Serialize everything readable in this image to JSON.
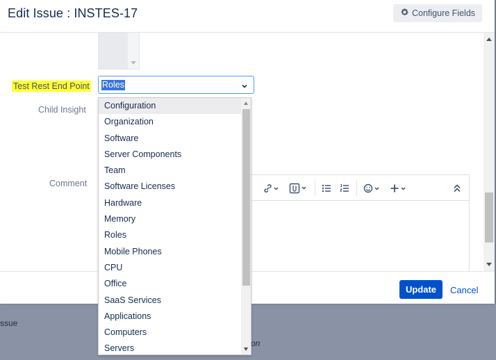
{
  "modal": {
    "title": "Edit Issue : INSTES-17",
    "configure_label": "Configure Fields"
  },
  "fields": {
    "test_rest_label": "Test Rest End Point",
    "test_rest_value": "Roles",
    "child_insight_label": "Child Insight",
    "comment_label": "Comment"
  },
  "dropdown": {
    "options": [
      "Configuration",
      "Organization",
      "Software",
      "Server Components",
      "Team",
      "Software Licenses",
      "Hardware",
      "Memory",
      "Roles",
      "Mobile Phones",
      "CPU",
      "Office",
      "SaaS Services",
      "Applications",
      "Computers",
      "Servers"
    ],
    "highlighted": "Configuration"
  },
  "toolbar": {
    "icons": [
      "link-icon",
      "attachment-icon",
      "bullet-list-icon",
      "numbered-list-icon",
      "emoji-icon",
      "insert-plus-icon",
      "collapse-icon"
    ]
  },
  "footer": {
    "update_label": "Update",
    "cancel_label": "Cancel"
  },
  "background": {
    "issue_text": "ssue",
    "on_text": "on"
  },
  "colors": {
    "primary": "#0052cc",
    "highlight": "#ffff33",
    "selection": "#3875d7"
  }
}
